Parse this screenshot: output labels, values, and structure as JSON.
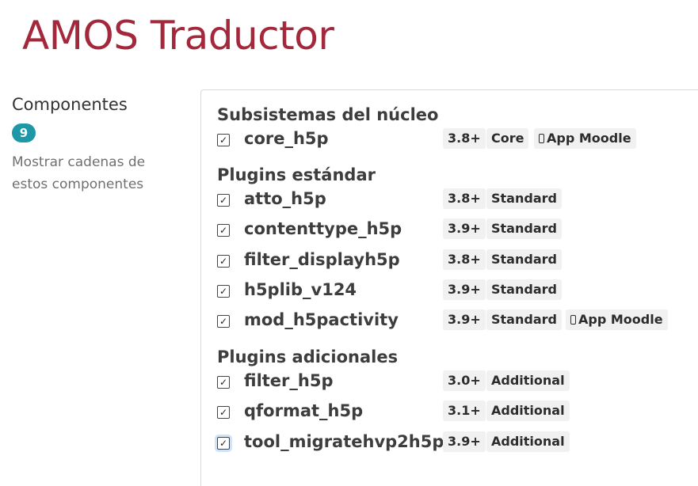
{
  "header": {
    "title": "AMOS Traductor"
  },
  "sidebar": {
    "heading": "Componentes",
    "count": "9",
    "help_text": "Mostrar cadenas de estos componentes"
  },
  "groups": [
    {
      "title": "Subsistemas del núcleo",
      "items": [
        {
          "name": "core_h5p",
          "version": "3.8+",
          "type": "Core",
          "app": "App Moodle",
          "checked": true
        }
      ]
    },
    {
      "title": "Plugins estándar",
      "items": [
        {
          "name": "atto_h5p",
          "version": "3.8+",
          "type": "Standard",
          "checked": true
        },
        {
          "name": "contenttype_h5p",
          "version": "3.9+",
          "type": "Standard",
          "checked": true
        },
        {
          "name": "filter_displayh5p",
          "version": "3.8+",
          "type": "Standard",
          "checked": true
        },
        {
          "name": "h5plib_v124",
          "version": "3.9+",
          "type": "Standard",
          "checked": true
        },
        {
          "name": "mod_h5pactivity",
          "version": "3.9+",
          "type": "Standard",
          "app": "App Moodle",
          "checked": true
        }
      ]
    },
    {
      "title": "Plugins adicionales",
      "items": [
        {
          "name": "filter_h5p",
          "version": "3.0+",
          "type": "Additional",
          "checked": true
        },
        {
          "name": "qformat_h5p",
          "version": "3.1+",
          "type": "Additional",
          "checked": true
        },
        {
          "name": "tool_migratehvp2h5p",
          "version": "3.9+",
          "type": "Additional",
          "checked": true
        }
      ]
    }
  ],
  "icons": {
    "checkbox": "checkbox-checked-icon",
    "app": "mobile-phone-icon"
  },
  "colors": {
    "title": "#a3283c",
    "badge": "#1e98a6",
    "tag_bg": "#f1f1f1"
  }
}
